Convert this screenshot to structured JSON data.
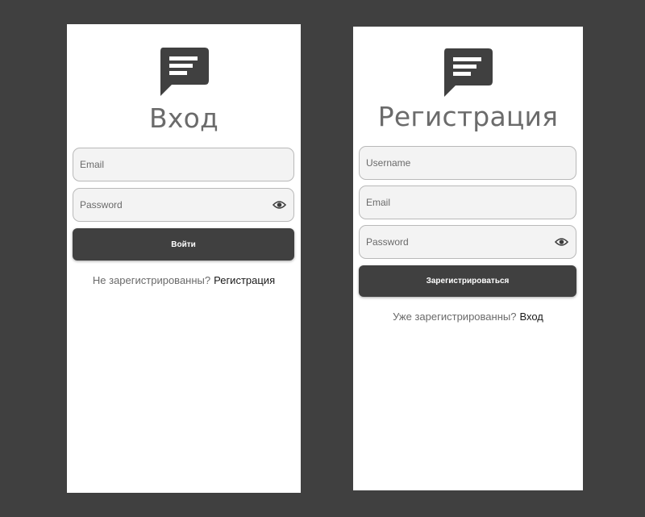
{
  "colors": {
    "background": "#404040",
    "card": "#ffffff",
    "accent": "#404040",
    "field_bg": "#f3f3f3",
    "field_border": "#b9b9b9",
    "title": "#6b6b6b"
  },
  "login": {
    "logo_icon": "chat-message-icon",
    "title": "Вход",
    "email_placeholder": "Email",
    "password_placeholder": "Password",
    "password_toggle_icon": "eye-icon",
    "submit_label": "Войти",
    "prompt_text": "Не зарегистрированны?",
    "prompt_link": "Регистрация"
  },
  "register": {
    "logo_icon": "chat-message-icon",
    "title": "Регистрация",
    "username_placeholder": "Username",
    "email_placeholder": "Email",
    "password_placeholder": "Password",
    "password_toggle_icon": "eye-icon",
    "submit_label": "Зарегистрироваться",
    "prompt_text": "Уже зарегистрированны?",
    "prompt_link": "Вход"
  }
}
